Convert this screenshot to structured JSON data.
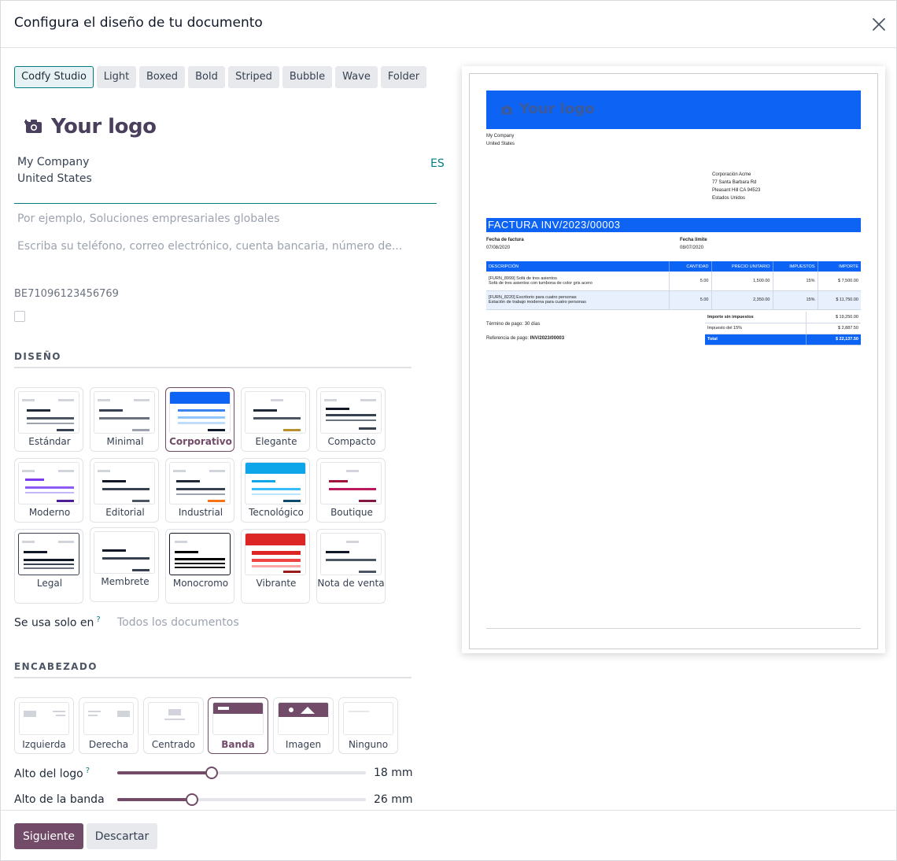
{
  "dialog": {
    "title": "Configura el diseño de tu documento",
    "close_label": "×"
  },
  "style_tabs": [
    {
      "label": "Codfy Studio",
      "active": true
    },
    {
      "label": "Light"
    },
    {
      "label": "Boxed"
    },
    {
      "label": "Bold"
    },
    {
      "label": "Striped"
    },
    {
      "label": "Bubble"
    },
    {
      "label": "Wave"
    },
    {
      "label": "Folder"
    }
  ],
  "company": {
    "logo_text": "Your logo",
    "name": "My Company",
    "country": "United States",
    "lang": "ES",
    "tagline_placeholder": "Por ejemplo, Soluciones empresariales globales",
    "details_placeholder": "Escriba su teléfono, correo electrónico, cuenta bancaria, número de...",
    "vat": "BE71096123456769"
  },
  "design_section": {
    "title": "DISEÑO",
    "templates": [
      {
        "label": "Estándar"
      },
      {
        "label": "Minimal"
      },
      {
        "label": "Corporativo",
        "active": true
      },
      {
        "label": "Elegante"
      },
      {
        "label": "Compacto"
      },
      {
        "label": "Moderno"
      },
      {
        "label": "Editorial"
      },
      {
        "label": "Industrial"
      },
      {
        "label": "Tecnológico"
      },
      {
        "label": "Boutique"
      },
      {
        "label": "Legal"
      },
      {
        "label": "Membrete"
      },
      {
        "label": "Monocromo"
      },
      {
        "label": "Vibrante"
      },
      {
        "label": "Nota de venta"
      }
    ],
    "used_in_label": "Se usa solo en",
    "used_in_help": "?",
    "used_in_value": "Todos los documentos"
  },
  "header_section": {
    "title": "ENCABEZADO",
    "options": [
      {
        "label": "Izquierda"
      },
      {
        "label": "Derecha"
      },
      {
        "label": "Centrado"
      },
      {
        "label": "Banda",
        "active": true
      },
      {
        "label": "Imagen"
      },
      {
        "label": "Ninguno"
      }
    ],
    "sliders": [
      {
        "label": "Alto del logo",
        "help": "?",
        "value": "18 mm",
        "fraction": 0.38
      },
      {
        "label": "Alto de la banda",
        "value": "26 mm",
        "fraction": 0.3
      }
    ]
  },
  "footer": {
    "next_label": "Siguiente",
    "discard_label": "Descartar"
  },
  "colors": {
    "primary": "#714B67",
    "accent": "#017e84",
    "preview_brand": "#0d64f4"
  },
  "preview": {
    "logo_text": "Your logo",
    "company_lines": [
      "My Company",
      "United States"
    ],
    "customer_lines": [
      "Corporación Acme",
      "77 Santa Barbara Rd",
      "Pleasant Hill CA 94523",
      "Estados Unidos"
    ],
    "title": "FACTURA INV/2023/00003",
    "invoice_date_label": "Fecha de factura",
    "invoice_date": "07/08/2020",
    "due_date_label": "Fecha límite",
    "due_date": "08/07/2020",
    "columns": [
      "DESCRIPCIÓN",
      "CANTIDAD",
      "PRECIO UNITARIO",
      "IMPUESTOS",
      "IMPORTE"
    ],
    "lines": [
      {
        "desc1": "[FURN_8999] Sofá de tres asientos",
        "desc2": "Sofá de tres asientos con tumbona de color gris acero",
        "qty": "5.00",
        "price": "1,500.00",
        "tax": "15%",
        "amount": "$ 7,500.00"
      },
      {
        "desc1": "[FURN_8220] Escritorio para cuatro personas",
        "desc2": "Estación de trabajo moderna para cuatro personas",
        "qty": "5.00",
        "price": "2,350.00",
        "tax": "15%",
        "amount": "$ 11,750.00"
      }
    ],
    "payment_term": "Término de pago: 30 días",
    "payment_ref_label": "Referencia de pago:",
    "payment_ref": "INV/2023/00003",
    "untaxed_label": "Importe sin impuestos",
    "untaxed_value": "$ 19,250.00",
    "tax_label": "Impuesto del 15%",
    "tax_value": "$ 2,887.50",
    "total_label": "Total",
    "total_value": "$ 22,137.50"
  }
}
